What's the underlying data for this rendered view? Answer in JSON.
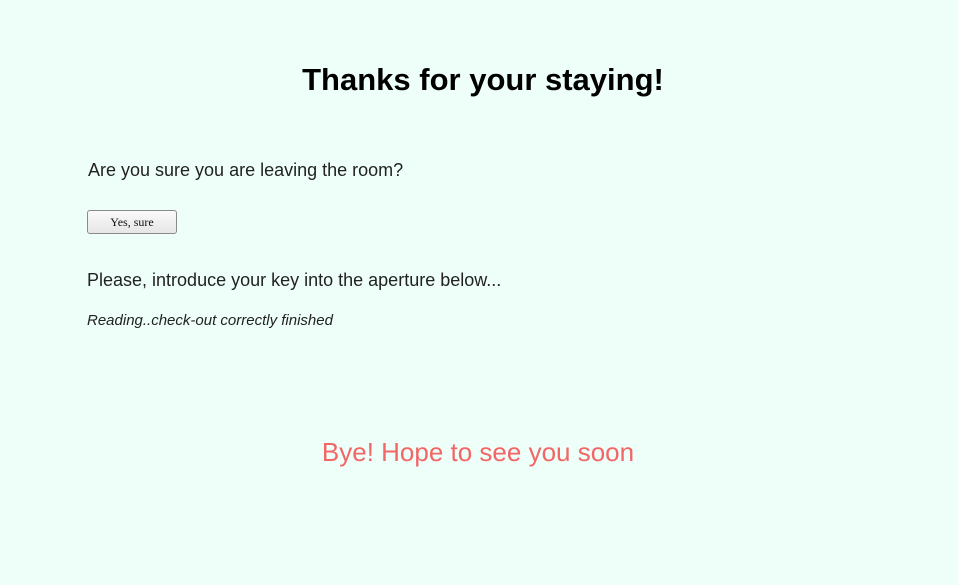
{
  "page": {
    "title": "Thanks for your staying!",
    "question": "Are you sure you are leaving the room?",
    "confirm_button_label": "Yes, sure",
    "instruction": "Please, introduce your key into the aperture below...",
    "status": "Reading..check-out correctly finished",
    "farewell": "Bye! Hope to see you soon"
  },
  "colors": {
    "background": "#eefffa",
    "farewell": "#f26666",
    "title": "#000000"
  }
}
